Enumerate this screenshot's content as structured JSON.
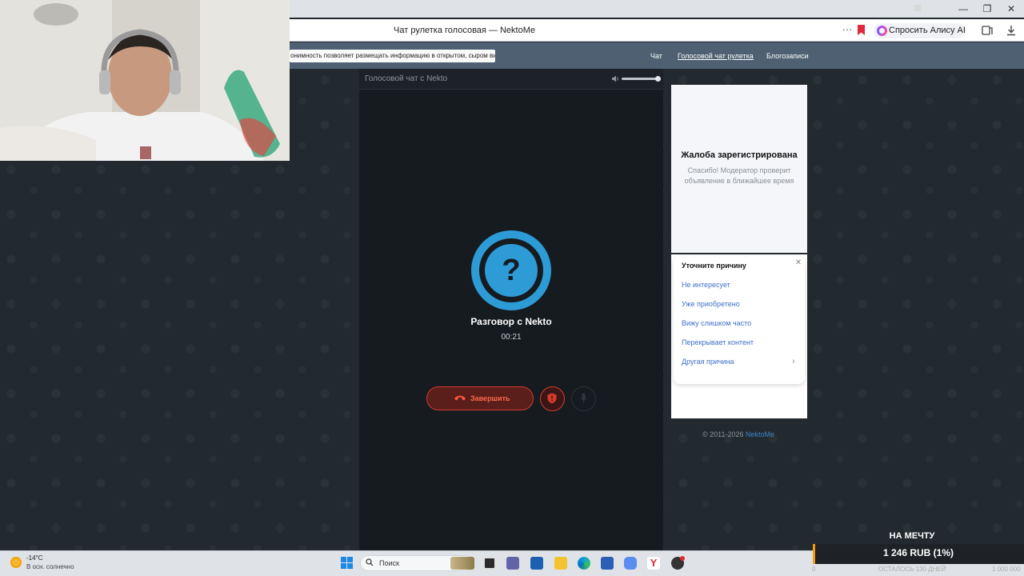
{
  "browser": {
    "tab_title": "Чат рулетка голосовая — NektoMe",
    "window_controls": [
      "≡",
      "—",
      "❐",
      "✕"
    ],
    "more_menu": "···",
    "alice_button": "Спросить Алису AI",
    "colors": {
      "bookmark": "#e0293a",
      "address_bar": "#ffffff"
    }
  },
  "site": {
    "notice": "онимность позволяет размещать информацию в открытом, сыром виде!",
    "nav": [
      "Чат",
      "Голосовой чат рулетка",
      "Блогозаписи"
    ],
    "nav_active": "Голосовой чат рулетка",
    "header_color": "#4e6072"
  },
  "chat": {
    "header_title": "Голосовой чат с Nekto",
    "volume_icon": "speaker-icon",
    "avatar_glyph": "?",
    "peer_name": "Разговор с Nekto",
    "timer": "00:21",
    "end_button": "Завершить",
    "accent_color": "#2d9bd6",
    "danger_color": "#d63b2a"
  },
  "ad": {
    "title": "Жалоба зарегистрирована",
    "subtitle": "Спасибо! Модератор проверит объявление в ближайшее время",
    "reason_title": "Уточните причину",
    "reasons": [
      "Не интересует",
      "Уже приобретено",
      "Вижу слишком часто",
      "Перекрывает контент",
      "Другая причина"
    ]
  },
  "footer": {
    "copyright": "© 2011-2026",
    "brand": "NektoMe"
  },
  "taskbar": {
    "temperature": "-14°C",
    "weather": "В осн. солнечно",
    "search_placeholder": "Поиск"
  },
  "donation": {
    "title": "НА МЕЧТУ",
    "value": "1 246 RUB (1%)",
    "left_value": "0",
    "days_left": "ОСТАЛОСЬ 130 ДНЕЙ",
    "right_value": "1 000 000"
  }
}
